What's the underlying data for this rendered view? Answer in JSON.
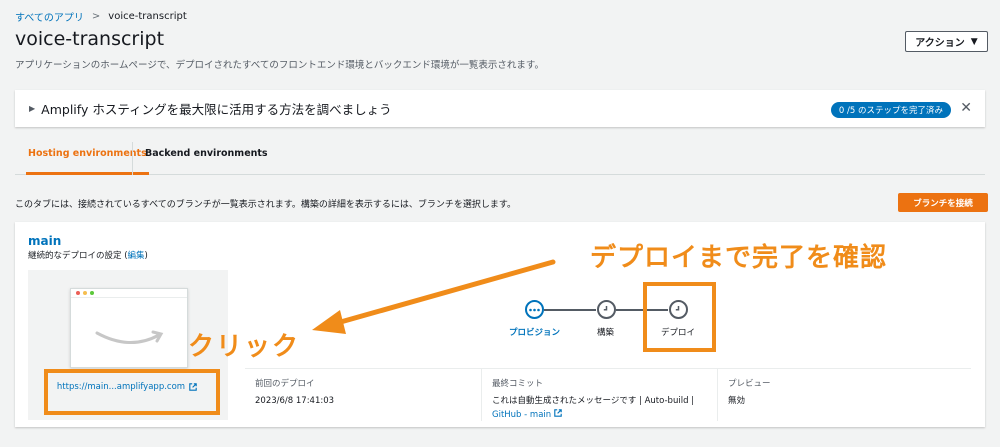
{
  "breadcrumb": {
    "root": "すべてのアプリ",
    "separator": ">",
    "current": "voice-transcript"
  },
  "page": {
    "title": "voice-transcript",
    "description": "アプリケーションのホームページで、デプロイされたすべてのフロントエンド環境とバックエンド環境が一覧表示されます。"
  },
  "actions": {
    "label": "アクション",
    "caret": "▼"
  },
  "banner": {
    "toggle": "▶",
    "text": "Amplify ホスティングを最大限に活用する方法を調べましょう",
    "badge": "0 /5 のステップを完了済み",
    "close": "✕"
  },
  "tabs": [
    {
      "label": "Hosting environments",
      "active": true
    },
    {
      "label": "Backend environments",
      "active": false
    }
  ],
  "tab_description": "このタブには、接続されているすべてのブランチが一覧表示されます。構築の詳細を表示するには、ブランチを選択します。",
  "connect_branch": {
    "label": "ブランチを接続"
  },
  "branch": {
    "name": "main",
    "cd_label": "継続的なデプロイの設定 (",
    "cd_edit": "編集",
    "cd_close": ")",
    "url": "https://main...amplifyapp.com",
    "steps": [
      {
        "label": "プロビジョン",
        "state": "active"
      },
      {
        "label": "構築",
        "state": "pending"
      },
      {
        "label": "デプロイ",
        "state": "pending"
      }
    ],
    "last_deploy": {
      "label": "前回のデプロイ",
      "value": "2023/6/8 17:41:03"
    },
    "last_commit": {
      "label": "最終コミット",
      "message": "これは自動生成されたメッセージです | Auto-build |",
      "link": "GitHub - main"
    },
    "preview": {
      "label": "プレビュー",
      "value": "無効"
    }
  },
  "annotations": {
    "deploy_note": "デプロイまで完了を確認",
    "click_note": "クリック",
    "color": "#f08c1a"
  },
  "colors": {
    "accent": "#ec7211",
    "link": "#0073bb",
    "annotation": "#f08c1a"
  }
}
